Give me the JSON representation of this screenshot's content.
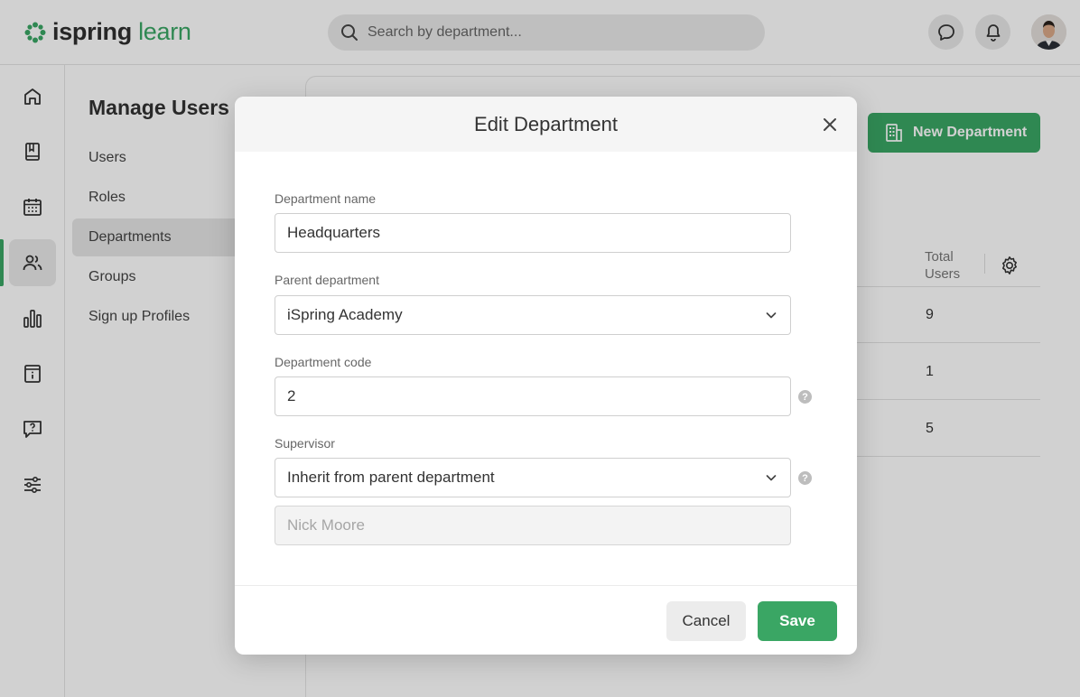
{
  "brand": {
    "name_primary": "ispring",
    "name_secondary": "learn",
    "accent_color": "#3aa664"
  },
  "search": {
    "placeholder": "Search by department..."
  },
  "topbar_icons": [
    "chat-icon",
    "bell-icon"
  ],
  "sidenav": {
    "items": [
      "home-icon",
      "book-icon",
      "calendar-icon",
      "users-icon",
      "bar-chart-icon",
      "info-card-icon",
      "question-chat-icon",
      "sliders-icon"
    ],
    "active": "users-icon"
  },
  "submenu": {
    "title": "Manage Users",
    "items": [
      {
        "label": "Users"
      },
      {
        "label": "Roles"
      },
      {
        "label": "Departments"
      },
      {
        "label": "Groups"
      },
      {
        "label": "Sign up Profiles"
      }
    ],
    "active": "Departments"
  },
  "content": {
    "new_department_label": "New Department",
    "total_users_header": "Total Users",
    "rows": [
      {
        "total": "9"
      },
      {
        "total": "1"
      },
      {
        "total": "5"
      }
    ]
  },
  "modal": {
    "title": "Edit Department",
    "department_name": {
      "label": "Department name",
      "value": "Headquarters"
    },
    "parent_department": {
      "label": "Parent department",
      "value": "iSpring Academy"
    },
    "department_code": {
      "label": "Department code",
      "value": "2"
    },
    "supervisor": {
      "label": "Supervisor",
      "value": "Inherit from parent department",
      "inherited_name": "Nick Moore"
    },
    "cancel_label": "Cancel",
    "save_label": "Save"
  }
}
